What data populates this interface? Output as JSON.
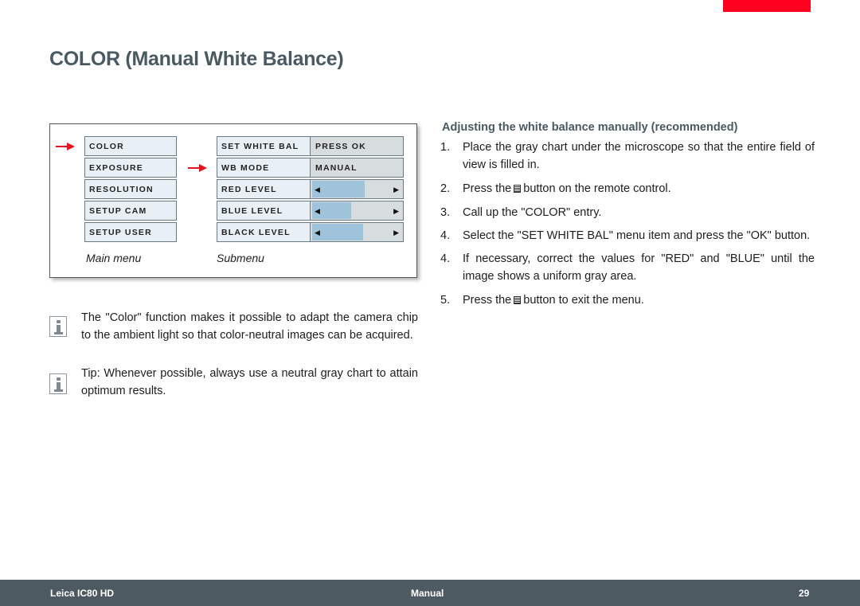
{
  "page": {
    "title": "COLOR (Manual White Balance)",
    "accent_color": "#ff0021"
  },
  "figure": {
    "main_menu": {
      "caption": "Main menu",
      "items": [
        "COLOR",
        "EXPOSURE",
        "RESOLUTION",
        "SETUP CAM",
        "SETUP USER"
      ],
      "selected": "COLOR"
    },
    "submenu": {
      "caption": "Submenu",
      "selected": "WB MODE",
      "rows": [
        {
          "label": "SET WHITE BAL",
          "value": "PRESS OK"
        },
        {
          "label": "WB MODE",
          "value": "MANUAL"
        },
        {
          "label": "RED LEVEL",
          "level_percent": 57
        },
        {
          "label": "BLUE LEVEL",
          "level_percent": 42
        },
        {
          "label": "BLACK LEVEL",
          "level_percent": 55
        }
      ],
      "left_arrow": "◀",
      "right_arrow": "▶"
    }
  },
  "notes": [
    {
      "icon": "info-icon",
      "text": "The \"Color\" function makes it possible to adapt the camera chip to the ambient light so that color-neutral images can be acquired."
    },
    {
      "icon": "info-icon",
      "text": "Tip: Whenever possible, always use a neutral gray chart to attain optimum results."
    }
  ],
  "procedure": {
    "heading": "Adjusting the white balance manually (recommended)",
    "steps": [
      {
        "num": "1.",
        "text": "Place the gray chart under the microscope so that the entire field of view is filled in."
      },
      {
        "num": "2.",
        "pre": "Press the",
        "post": "button on the remote control."
      },
      {
        "num": "3.",
        "text": "Call up the \"COLOR\" entry."
      },
      {
        "num": "4.",
        "text": "Select the \"SET WHITE BAL\" menu item and press the \"OK\" button."
      },
      {
        "num": "4.",
        "text": "If necessary, correct the values for \"RED\" and \"BLUE\" until the image shows a uniform gray area."
      },
      {
        "num": "5.",
        "pre": "Press the",
        "post": "button to exit the menu."
      }
    ]
  },
  "footer": {
    "product": "Leica IC80 HD",
    "doc_type": "Manual",
    "page_number": "29"
  }
}
